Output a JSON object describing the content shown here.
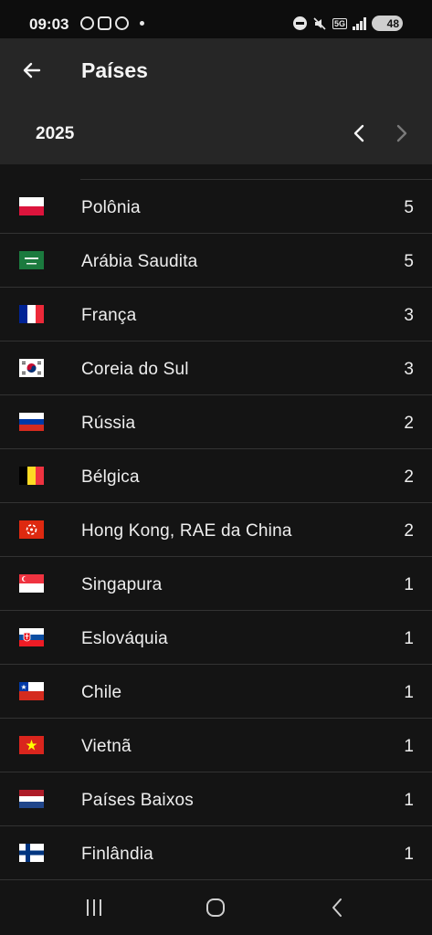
{
  "status_bar": {
    "time": "09:03",
    "network": "5G",
    "battery": "48",
    "icons": [
      "notification-icon",
      "screenshot-icon",
      "accessibility-icon",
      "dot-icon",
      "dnd-icon",
      "mute-icon",
      "5g-icon",
      "signal-icon",
      "battery-icon"
    ]
  },
  "header": {
    "title": "Países",
    "back_icon": "arrow-left-icon"
  },
  "year_selector": {
    "year": "2025",
    "prev_icon": "chevron-left-icon",
    "next_icon": "chevron-right-icon"
  },
  "countries": [
    {
      "name": "Polônia",
      "count": "5",
      "flag": "poland-flag-icon"
    },
    {
      "name": "Arábia Saudita",
      "count": "5",
      "flag": "saudi-arabia-flag-icon"
    },
    {
      "name": "França",
      "count": "3",
      "flag": "france-flag-icon"
    },
    {
      "name": "Coreia do Sul",
      "count": "3",
      "flag": "south-korea-flag-icon"
    },
    {
      "name": "Rússia",
      "count": "2",
      "flag": "russia-flag-icon"
    },
    {
      "name": "Bélgica",
      "count": "2",
      "flag": "belgium-flag-icon"
    },
    {
      "name": "Hong Kong, RAE da China",
      "count": "2",
      "flag": "hong-kong-flag-icon"
    },
    {
      "name": "Singapura",
      "count": "1",
      "flag": "singapore-flag-icon"
    },
    {
      "name": "Eslováquia",
      "count": "1",
      "flag": "slovakia-flag-icon"
    },
    {
      "name": "Chile",
      "count": "1",
      "flag": "chile-flag-icon"
    },
    {
      "name": "Vietnã",
      "count": "1",
      "flag": "vietnam-flag-icon"
    },
    {
      "name": "Países Baixos",
      "count": "1",
      "flag": "netherlands-flag-icon"
    },
    {
      "name": "Finlândia",
      "count": "1",
      "flag": "finland-flag-icon"
    }
  ],
  "nav_bar": {
    "recent_icon": "recent-apps-icon",
    "home_icon": "home-icon",
    "back_icon": "back-icon"
  },
  "colors": {
    "background": "#141414",
    "app_bar": "#262626",
    "divider": "#333333",
    "text": "#eeeeee"
  }
}
